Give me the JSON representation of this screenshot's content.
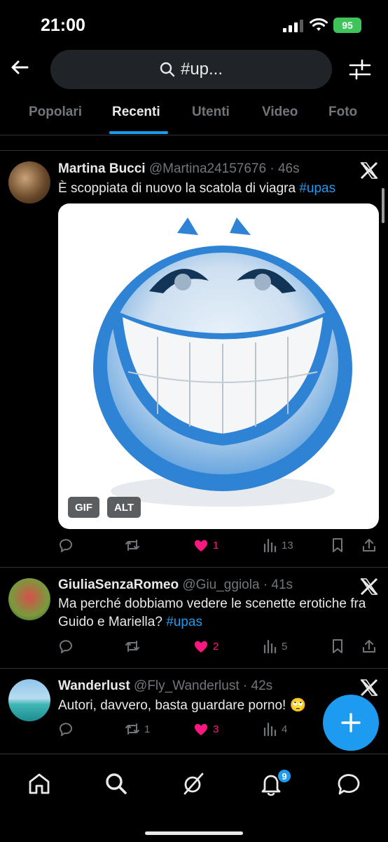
{
  "status_bar": {
    "time": "21:00",
    "battery": "95"
  },
  "search": {
    "query": "#up..."
  },
  "tabs": [
    {
      "label": "Popolari",
      "active": false
    },
    {
      "label": "Recenti",
      "active": true
    },
    {
      "label": "Utenti",
      "active": false
    },
    {
      "label": "Video",
      "active": false
    },
    {
      "label": "Foto",
      "active": false
    }
  ],
  "tweets": [
    {
      "name": "Martina Bucci",
      "handle": "@Martina24157676",
      "time": "· 46s",
      "text": "È scoppiata di nuovo la scatola di viagra ",
      "hashtag": "#upas",
      "media_badges": [
        "GIF",
        "ALT"
      ],
      "likes": "1",
      "views": "13"
    },
    {
      "name": "GiuliaSenzaRomeo",
      "handle": "@Giu_ggiola",
      "time": "· 41s",
      "text": "Ma perché dobbiamo vedere le scenette erotiche fra Guido e Mariella? ",
      "hashtag": "#upas",
      "likes": "2",
      "views": "5"
    },
    {
      "name": "Wanderlust",
      "handle": "@Fly_Wanderlust",
      "time": "· 42s",
      "text": "Autori, davvero, basta guardare porno! 🙄",
      "retweets": "1",
      "likes": "3",
      "views": "4"
    }
  ],
  "bottom_nav": {
    "notifications_count": "9"
  },
  "colors": {
    "accent": "#1d9bf0",
    "like": "#f91880",
    "muted": "#71767b",
    "battery": "#3ec45b"
  }
}
